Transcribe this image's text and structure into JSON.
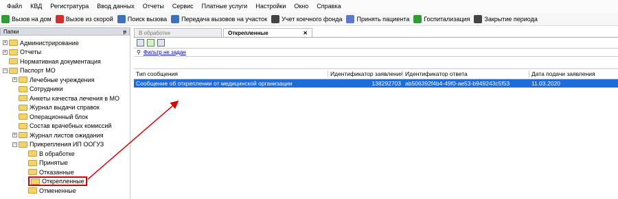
{
  "menu": [
    "Файл",
    "КВД",
    "Регистратура",
    "Ввод данных",
    "Отчеты",
    "Сервис",
    "Платные услуги",
    "Настройки",
    "Окно",
    "Справка"
  ],
  "toolbar": [
    {
      "label": "Вызов на дом",
      "icon": "check-green-icon",
      "color": "#2e9e2e"
    },
    {
      "label": "Вызов из скорой",
      "icon": "check-red-icon",
      "color": "#d03030"
    },
    {
      "label": "Поиск вызова",
      "icon": "search-doc-icon",
      "color": "#3c70c0"
    },
    {
      "label": "Передача вызовов на участок",
      "icon": "transfer-arrows-icon",
      "color": "#3c70c0"
    },
    {
      "label": "Учет коечного фонда",
      "icon": "bed-grid-icon",
      "color": "#444444"
    },
    {
      "label": "Принять пациента",
      "icon": "patient-doc-icon",
      "color": "#5a7ad0"
    },
    {
      "label": "Госпитализация",
      "icon": "hospital-icon",
      "color": "#2e9e2e"
    },
    {
      "label": "Закрытие периода",
      "icon": "calendar-icon",
      "color": "#444444"
    }
  ],
  "left_panel": {
    "title": "Папки",
    "pin": "ᵽ"
  },
  "tree": [
    {
      "label": "Администрирование",
      "exp": "+",
      "level": 0
    },
    {
      "label": "Отчеты",
      "exp": "+",
      "level": 0
    },
    {
      "label": "Нормативная документация",
      "exp": "",
      "level": 0
    },
    {
      "label": "Паспорт МО",
      "exp": "−",
      "level": 0
    },
    {
      "label": "Лечебные учреждения",
      "exp": "+",
      "level": 1
    },
    {
      "label": "Сотрудники",
      "exp": "",
      "level": 1
    },
    {
      "label": "Анкеты качества лечения в МО",
      "exp": "",
      "level": 1
    },
    {
      "label": "Журнал выдачи справок",
      "exp": "",
      "level": 1
    },
    {
      "label": "Операционный блок",
      "exp": "",
      "level": 1
    },
    {
      "label": "Состав врачебных комиссий",
      "exp": "",
      "level": 1
    },
    {
      "label": "Журнал листов ожидания",
      "exp": "+",
      "level": 1
    },
    {
      "label": "Прикрепления ИП ООГУЗ",
      "exp": "−",
      "level": 1
    },
    {
      "label": "В обработке",
      "exp": "",
      "level": 2
    },
    {
      "label": "Принятые",
      "exp": "",
      "level": 2
    },
    {
      "label": "Отказанные",
      "exp": "",
      "level": 2
    },
    {
      "label": "Открепленные",
      "exp": "",
      "level": 2,
      "selected": true
    },
    {
      "label": "Отмененные",
      "exp": "",
      "level": 2
    }
  ],
  "tabs": {
    "inactive": "В обработке",
    "active": "Открепленные",
    "close": "✕"
  },
  "filter": {
    "label": "Фильтр не задан"
  },
  "grid": {
    "headers": [
      "Тип сообщения",
      "Идентификатор заявления",
      "Идентификатор ответа",
      "Дата подачи заявления"
    ],
    "rows": [
      [
        "Сообщение об откреплении от медицинской организации",
        "138292703",
        "ab506392f4b4-49f0-ae53-b949243c5f53",
        "11.03.2020"
      ]
    ]
  },
  "colors": {
    "selection": "#1e6cd8",
    "annotation": "#e00000"
  }
}
